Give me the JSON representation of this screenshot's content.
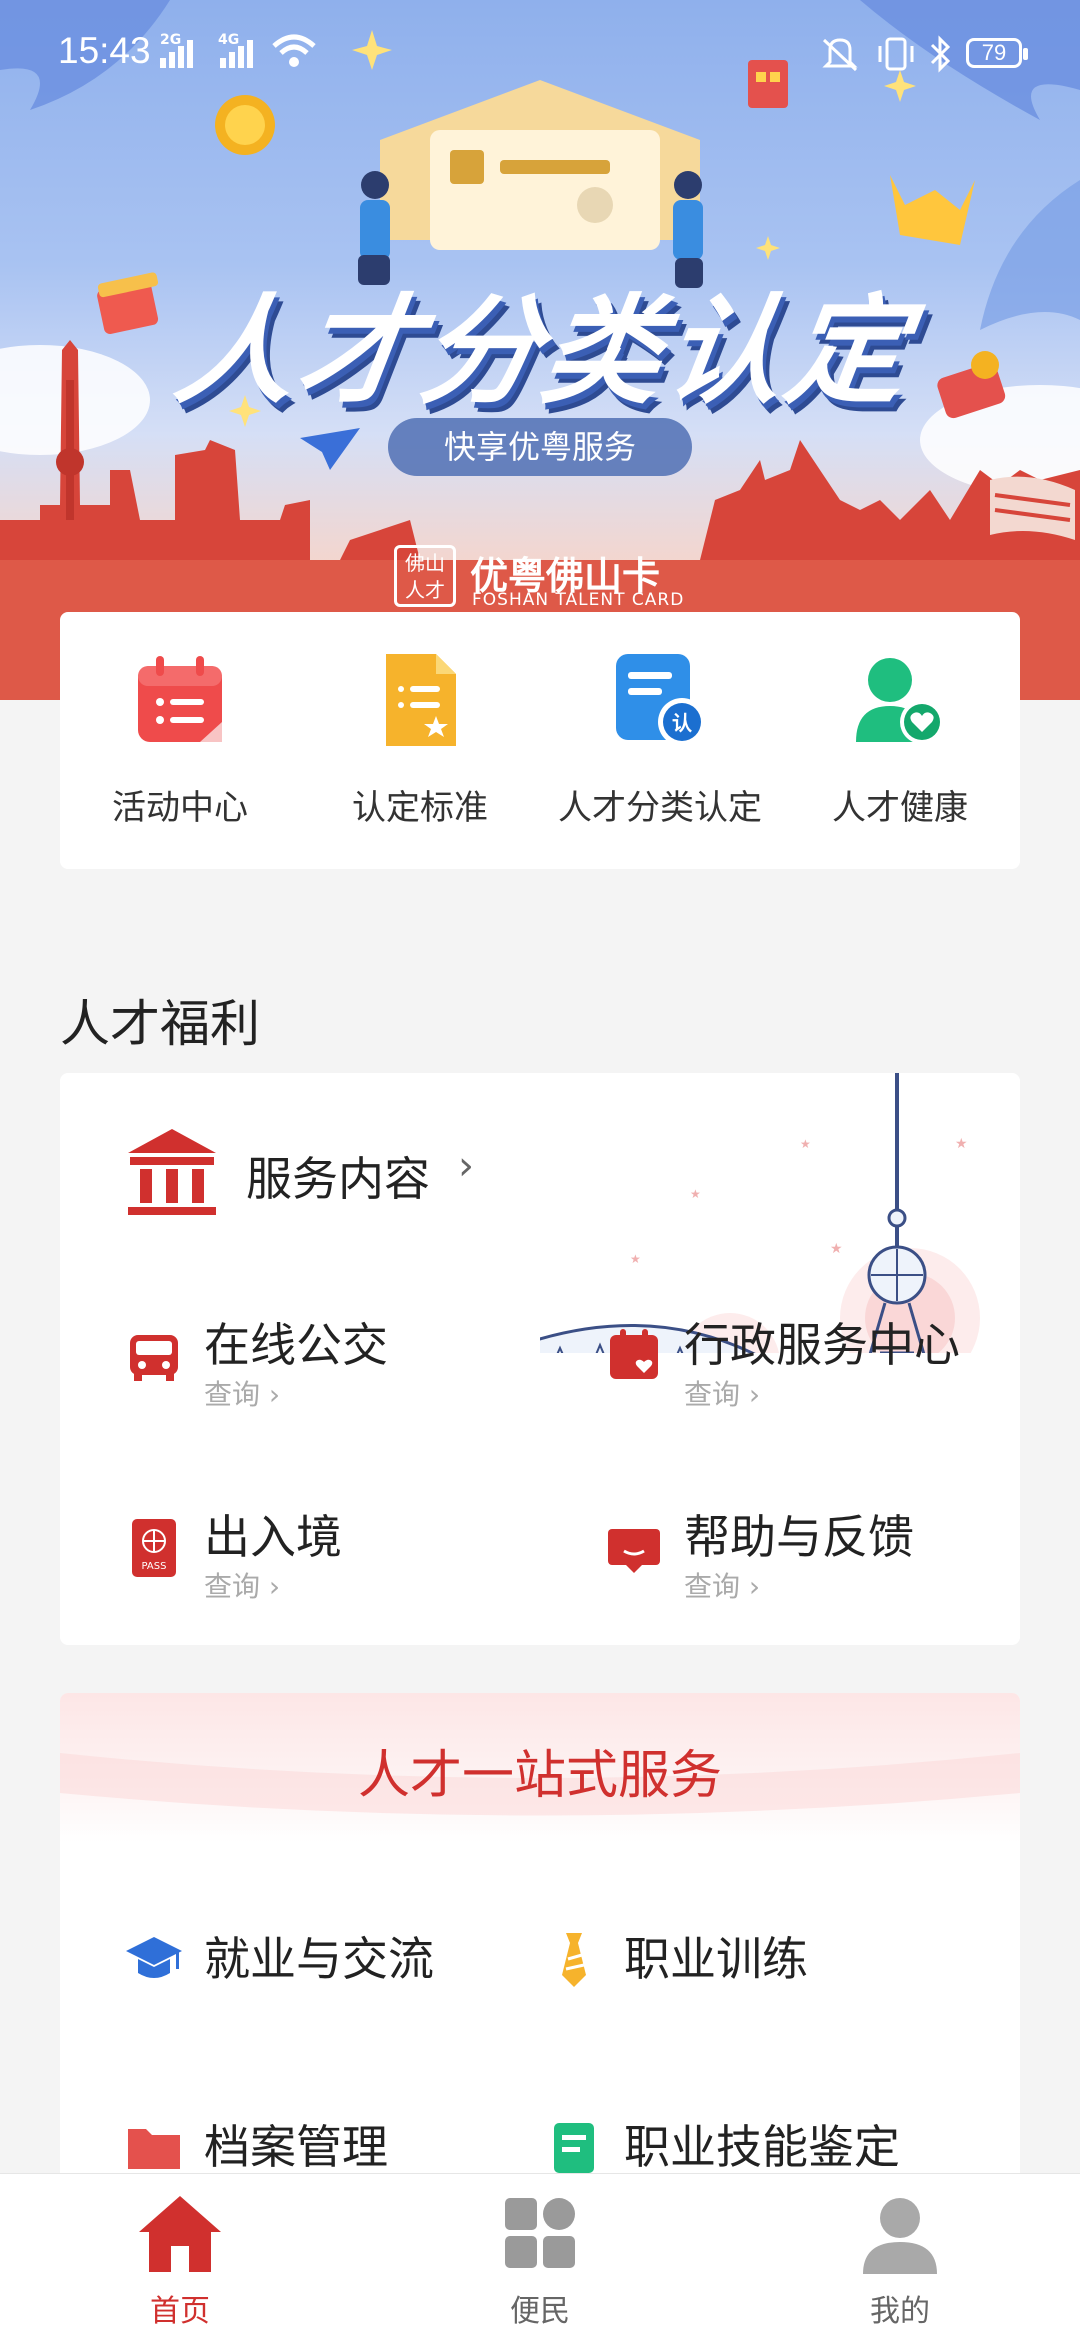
{
  "status_bar": {
    "time": "15:43",
    "net1": "2G",
    "net2": "4G",
    "battery": "79"
  },
  "banner": {
    "title": "人才分类认定",
    "pill": "快享优粤服务",
    "card_name": "优粤佛山卡",
    "card_en": "FOSHAN TALENT CARD",
    "seal": "佛山人才"
  },
  "quick_entries": [
    {
      "label": "活动中心",
      "icon": "calendar-list-icon",
      "color": "#ef4b4b"
    },
    {
      "label": "认定标准",
      "icon": "document-star-icon",
      "color": "#f6b32c"
    },
    {
      "label": "人才分类认定",
      "icon": "certify-badge-icon",
      "color": "#2f8fe8"
    },
    {
      "label": "人才健康",
      "icon": "person-heart-icon",
      "color": "#1fbe7f"
    }
  ],
  "welfare": {
    "section_title": "人才福利",
    "service_title": "服务内容",
    "items": [
      {
        "name": "在线公交",
        "sub": "查询",
        "icon": "bus-icon"
      },
      {
        "name": "行政服务中心",
        "sub": "查询",
        "icon": "calendar-heart-icon"
      },
      {
        "name": "出入境",
        "sub": "查询",
        "icon": "passport-icon"
      },
      {
        "name": "帮助与反馈",
        "sub": "查询",
        "icon": "feedback-icon"
      }
    ]
  },
  "onestop": {
    "title": "人才一站式服务",
    "items": [
      {
        "name": "就业与交流",
        "icon": "graduation-cap-icon",
        "color": "#2f6fd8"
      },
      {
        "name": "职业训练",
        "icon": "tie-icon",
        "color": "#f6b32c"
      },
      {
        "name": "档案管理",
        "icon": "folder-icon",
        "color": "#e4514d"
      },
      {
        "name": "职业技能鉴定",
        "icon": "report-icon",
        "color": "#1fbe7f"
      }
    ]
  },
  "tabs": [
    {
      "label": "首页",
      "icon": "home-icon",
      "active": true
    },
    {
      "label": "便民",
      "icon": "grid-icon",
      "active": false
    },
    {
      "label": "我的",
      "icon": "user-icon",
      "active": false
    }
  ],
  "colors": {
    "accent": "#d0302e",
    "page_bg": "#f4f4f4"
  }
}
